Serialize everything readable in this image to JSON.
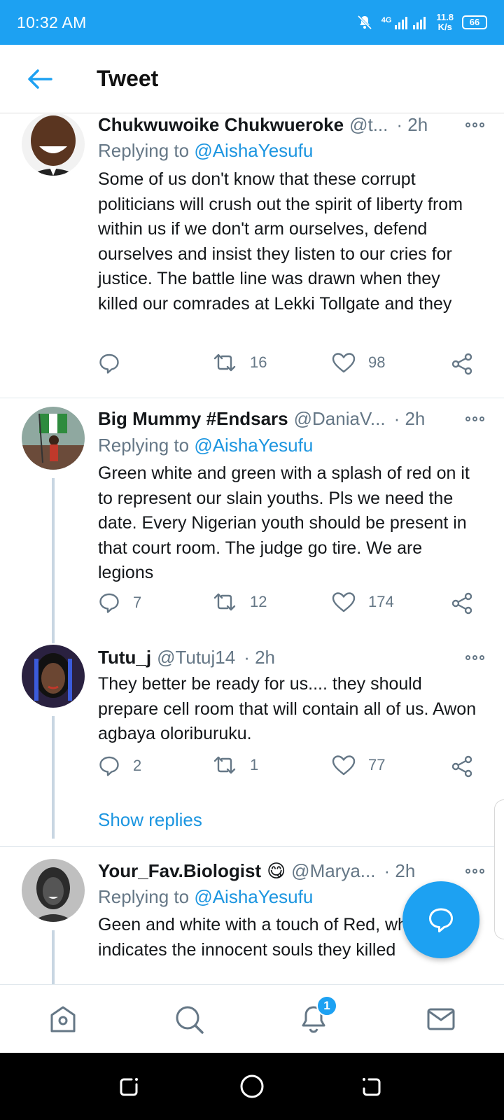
{
  "status_bar": {
    "time": "10:32 AM",
    "network_type": "4G",
    "speed_value": "11.8",
    "speed_unit": "K/s",
    "battery": "66"
  },
  "header": {
    "title": "Tweet"
  },
  "replying_prefix": "Replying to",
  "tweets": [
    {
      "name": "Chukwuwoike Chukwueroke",
      "handle": "@t...",
      "time": "· 2h",
      "replying_to": "@AishaYesufu",
      "text": "Some of us don't know that these corrupt politicians will crush out the spirit of liberty from within us if we don't arm ourselves, defend ourselves and insist they listen to our cries for justice. The battle line was drawn when they killed our comrades at Lekki Tollgate and they",
      "replies": "",
      "retweets": "16",
      "likes": "98"
    },
    {
      "name": "Big Mummy #Endsars",
      "handle": "@DaniaV...",
      "time": "· 2h",
      "replying_to": "@AishaYesufu",
      "text": "Green white and green with a splash of red on it to represent our slain youths. Pls we need the date. Every Nigerian youth should be present in that court room. The judge go tire. We are legions",
      "replies": "7",
      "retweets": "12",
      "likes": "174"
    },
    {
      "name": "Tutu_j",
      "handle": "@Tutuj14",
      "time": "· 2h",
      "replying_to": "",
      "text": "They better be ready for us.... they should prepare cell room that will contain all of us. Awon agbaya oloriburuku.",
      "replies": "2",
      "retweets": "1",
      "likes": "77"
    },
    {
      "name": "Your_Fav.Biologist",
      "emoji": "😋",
      "handle": "@Marya...",
      "time": "· 2h",
      "replying_to": "@AishaYesufu",
      "text": "Geen and white with a touch of Red, which indicates the innocent souls they killed"
    }
  ],
  "show_replies": "Show replies",
  "notifications_badge": "1",
  "colors": {
    "accent": "#1da1f2",
    "link": "#1b95e0",
    "muted": "#657786",
    "text": "#14171a"
  }
}
